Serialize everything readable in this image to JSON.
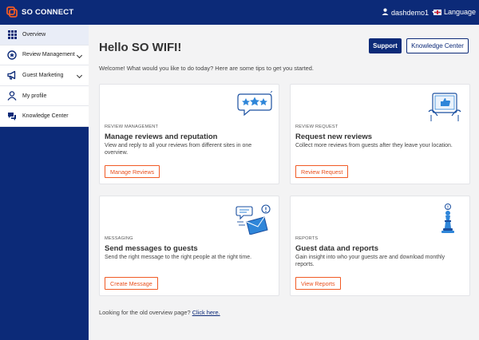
{
  "app": {
    "name": "SO CONNECT"
  },
  "topbar": {
    "username": "dashdemo1",
    "language_label": "Language"
  },
  "sidebar": {
    "items": [
      {
        "label": "Overview",
        "icon": "grid-icon",
        "has_chevron": false,
        "active": true
      },
      {
        "label": "Review Management",
        "icon": "star-badge-icon",
        "has_chevron": true,
        "active": false
      },
      {
        "label": "Guest Marketing",
        "icon": "megaphone-icon",
        "has_chevron": true,
        "active": false
      },
      {
        "label": "My profile",
        "icon": "user-icon",
        "has_chevron": false,
        "active": false
      },
      {
        "label": "Knowledge Center",
        "icon": "chat-bubbles-icon",
        "has_chevron": false,
        "active": false
      }
    ]
  },
  "main": {
    "greeting": "Hello SO WIFI!",
    "support_label": "Support",
    "knowledge_center_label": "Knowledge Center",
    "welcome": "Welcome! What would you like to do today? Here are some tips to get you started.",
    "cards": [
      {
        "category": "REVIEW MANAGEMENT",
        "title": "Manage reviews and reputation",
        "description": "View and reply to all your reviews from different sites in one overview.",
        "button": "Manage Reviews",
        "illustration": "stars-speech-bubble-icon"
      },
      {
        "category": "REVIEW REQUEST",
        "title": "Request new reviews",
        "description": "Collect more reviews from guests after they leave your location.",
        "button": "Review Request",
        "illustration": "tablet-thumbs-up-icon"
      },
      {
        "category": "MESSAGING",
        "title": "Send messages to guests",
        "description": "Send the right message to the right people at the right time.",
        "button": "Create Message",
        "illustration": "envelope-notification-icon"
      },
      {
        "category": "REPORTS",
        "title": "Guest data and reports",
        "description": "Gain insight into who your guests are and download monthly reports.",
        "button": "View Reports",
        "illustration": "chess-piece-icon"
      }
    ],
    "old_overview_text": "Looking for the old overview page?",
    "old_overview_link": "Click here."
  },
  "colors": {
    "brand": "#0c2a78",
    "accent": "#f15a24",
    "background": "#f3f3f4"
  }
}
